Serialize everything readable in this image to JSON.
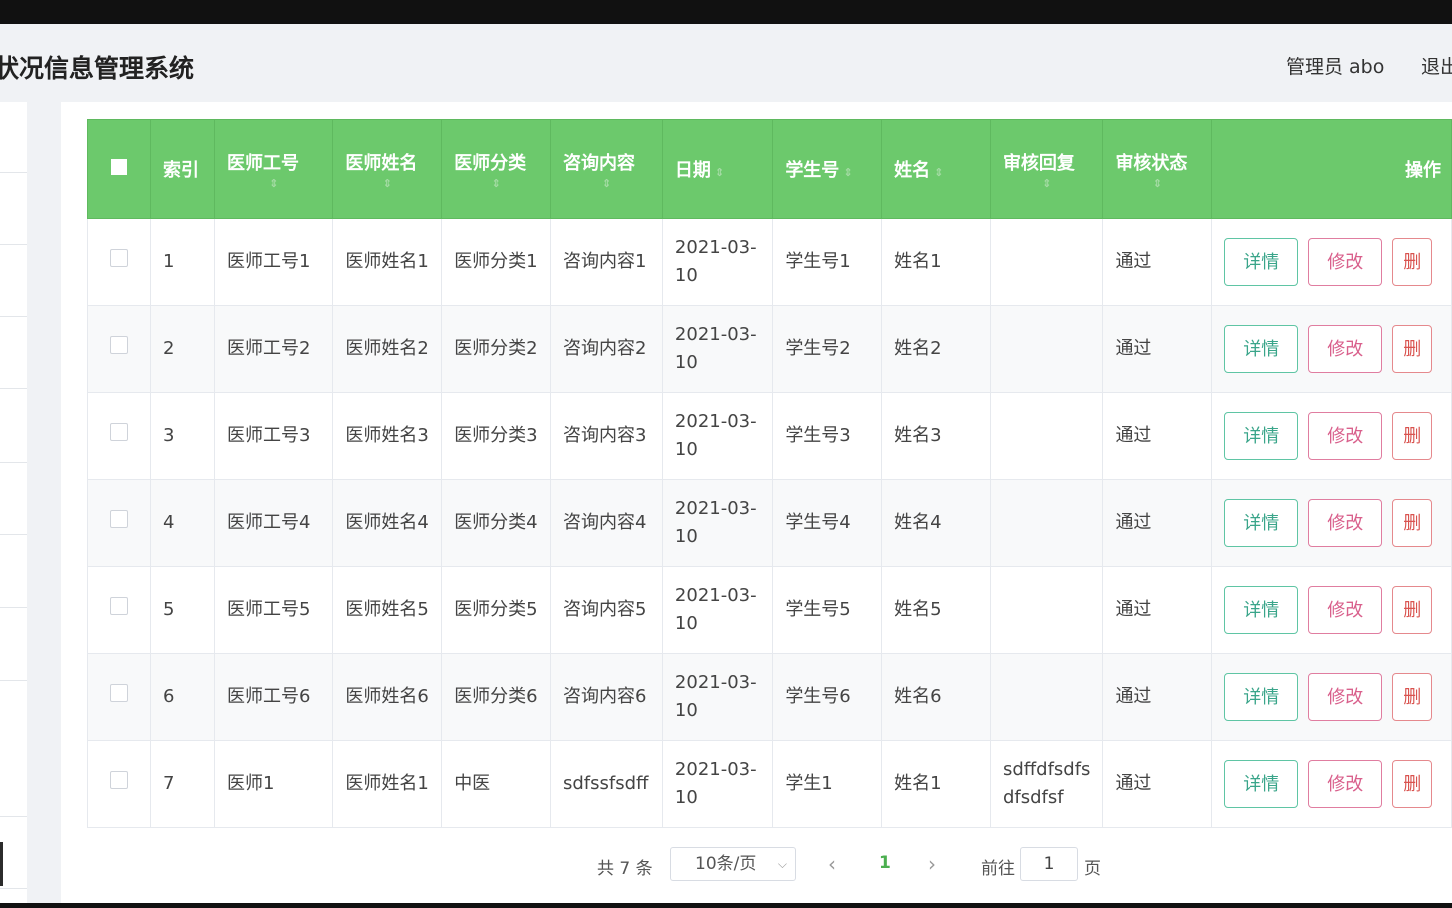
{
  "header": {
    "title": "状况信息管理系统",
    "admin": "管理员 abo",
    "logout": "退出"
  },
  "table": {
    "columns": [
      "索引",
      "医师工号",
      "医师姓名",
      "医师分类",
      "咨询内容",
      "日期",
      "学生号",
      "姓名",
      "审核回复",
      "审核状态",
      "操作"
    ],
    "sort_icon": "⇕",
    "rows": [
      {
        "index": "1",
        "doctor_no": "医师工号1",
        "doctor_name": "医师姓名1",
        "category": "医师分类1",
        "content": "咨询内容1",
        "date_a": "2021-03-",
        "date_b": "10",
        "student_no": "学生号1",
        "name": "姓名1",
        "reply_a": "",
        "reply_b": "",
        "status": "通过"
      },
      {
        "index": "2",
        "doctor_no": "医师工号2",
        "doctor_name": "医师姓名2",
        "category": "医师分类2",
        "content": "咨询内容2",
        "date_a": "2021-03-",
        "date_b": "10",
        "student_no": "学生号2",
        "name": "姓名2",
        "reply_a": "",
        "reply_b": "",
        "status": "通过"
      },
      {
        "index": "3",
        "doctor_no": "医师工号3",
        "doctor_name": "医师姓名3",
        "category": "医师分类3",
        "content": "咨询内容3",
        "date_a": "2021-03-",
        "date_b": "10",
        "student_no": "学生号3",
        "name": "姓名3",
        "reply_a": "",
        "reply_b": "",
        "status": "通过"
      },
      {
        "index": "4",
        "doctor_no": "医师工号4",
        "doctor_name": "医师姓名4",
        "category": "医师分类4",
        "content": "咨询内容4",
        "date_a": "2021-03-",
        "date_b": "10",
        "student_no": "学生号4",
        "name": "姓名4",
        "reply_a": "",
        "reply_b": "",
        "status": "通过"
      },
      {
        "index": "5",
        "doctor_no": "医师工号5",
        "doctor_name": "医师姓名5",
        "category": "医师分类5",
        "content": "咨询内容5",
        "date_a": "2021-03-",
        "date_b": "10",
        "student_no": "学生号5",
        "name": "姓名5",
        "reply_a": "",
        "reply_b": "",
        "status": "通过"
      },
      {
        "index": "6",
        "doctor_no": "医师工号6",
        "doctor_name": "医师姓名6",
        "category": "医师分类6",
        "content": "咨询内容6",
        "date_a": "2021-03-",
        "date_b": "10",
        "student_no": "学生号6",
        "name": "姓名6",
        "reply_a": "",
        "reply_b": "",
        "status": "通过"
      },
      {
        "index": "7",
        "doctor_no": "医师1",
        "doctor_name": "医师姓名1",
        "category": "中医",
        "content": "sdfssfsdff",
        "date_a": "2021-03-",
        "date_b": "10",
        "student_no": "学生1",
        "name": "姓名1",
        "reply_a": "sdffdfsdfs",
        "reply_b": "dfsdfsf",
        "status": "通过"
      }
    ],
    "actions": {
      "detail": "详情",
      "edit": "修改",
      "delete": "删"
    }
  },
  "pagination": {
    "total": "共 7 条",
    "page_size": "10条/页",
    "prev": "‹",
    "current": "1",
    "next": "›",
    "goto_prefix": "前往",
    "goto_value": "1",
    "goto_suffix": "页"
  },
  "colors": {
    "header_green": "#6cc96c",
    "accent": "#4caf50"
  }
}
